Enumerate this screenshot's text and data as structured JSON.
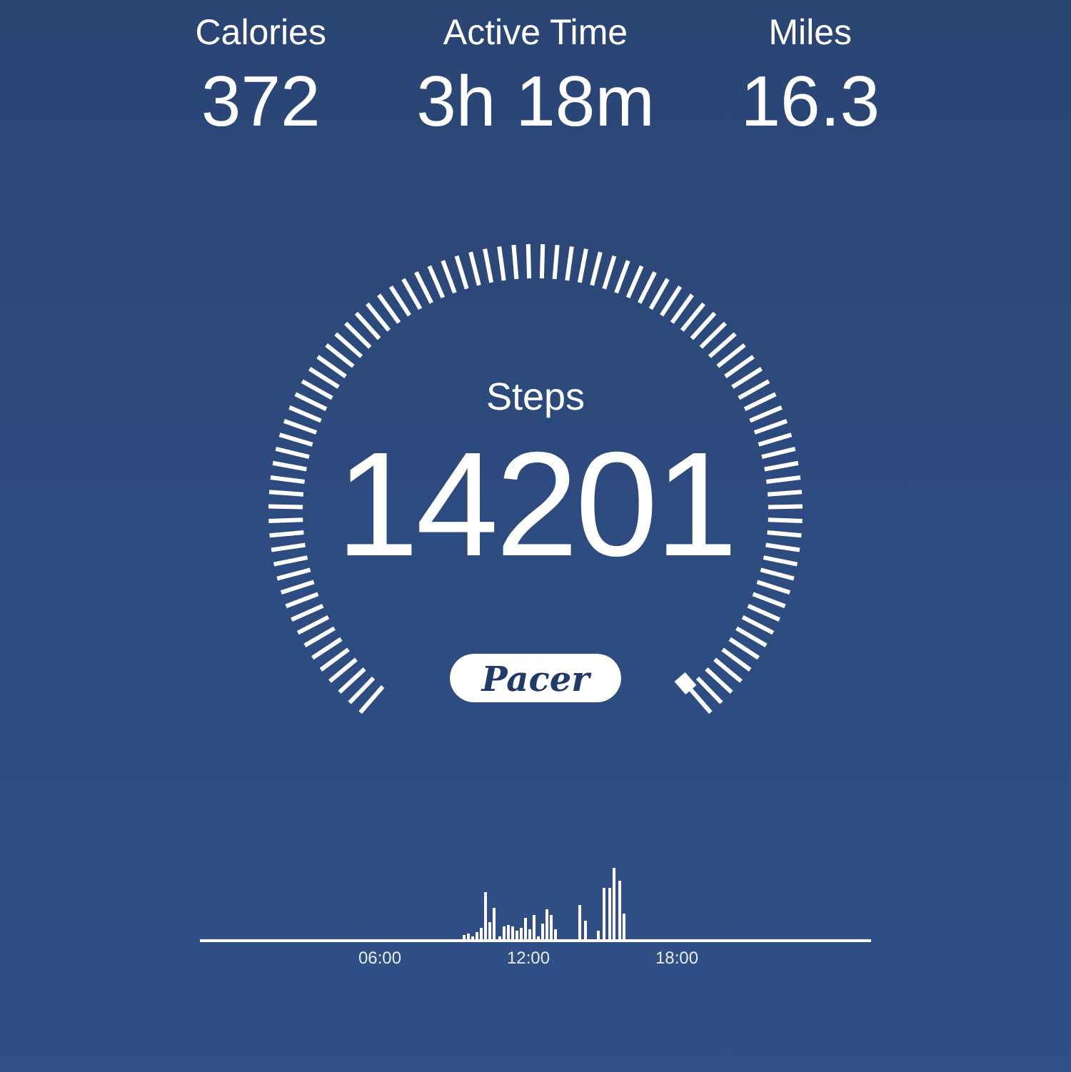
{
  "stats": [
    {
      "label": "Calories",
      "value": "372"
    },
    {
      "label": "Active Time",
      "value": "3h 18m"
    },
    {
      "label": "Miles",
      "value": "16.3"
    }
  ],
  "gauge": {
    "label": "Steps",
    "value": "14201"
  },
  "logo": {
    "text": "Pacer"
  },
  "activity_chart": {
    "tick_labels": [
      "06:00",
      "12:00",
      "18:00"
    ]
  }
}
